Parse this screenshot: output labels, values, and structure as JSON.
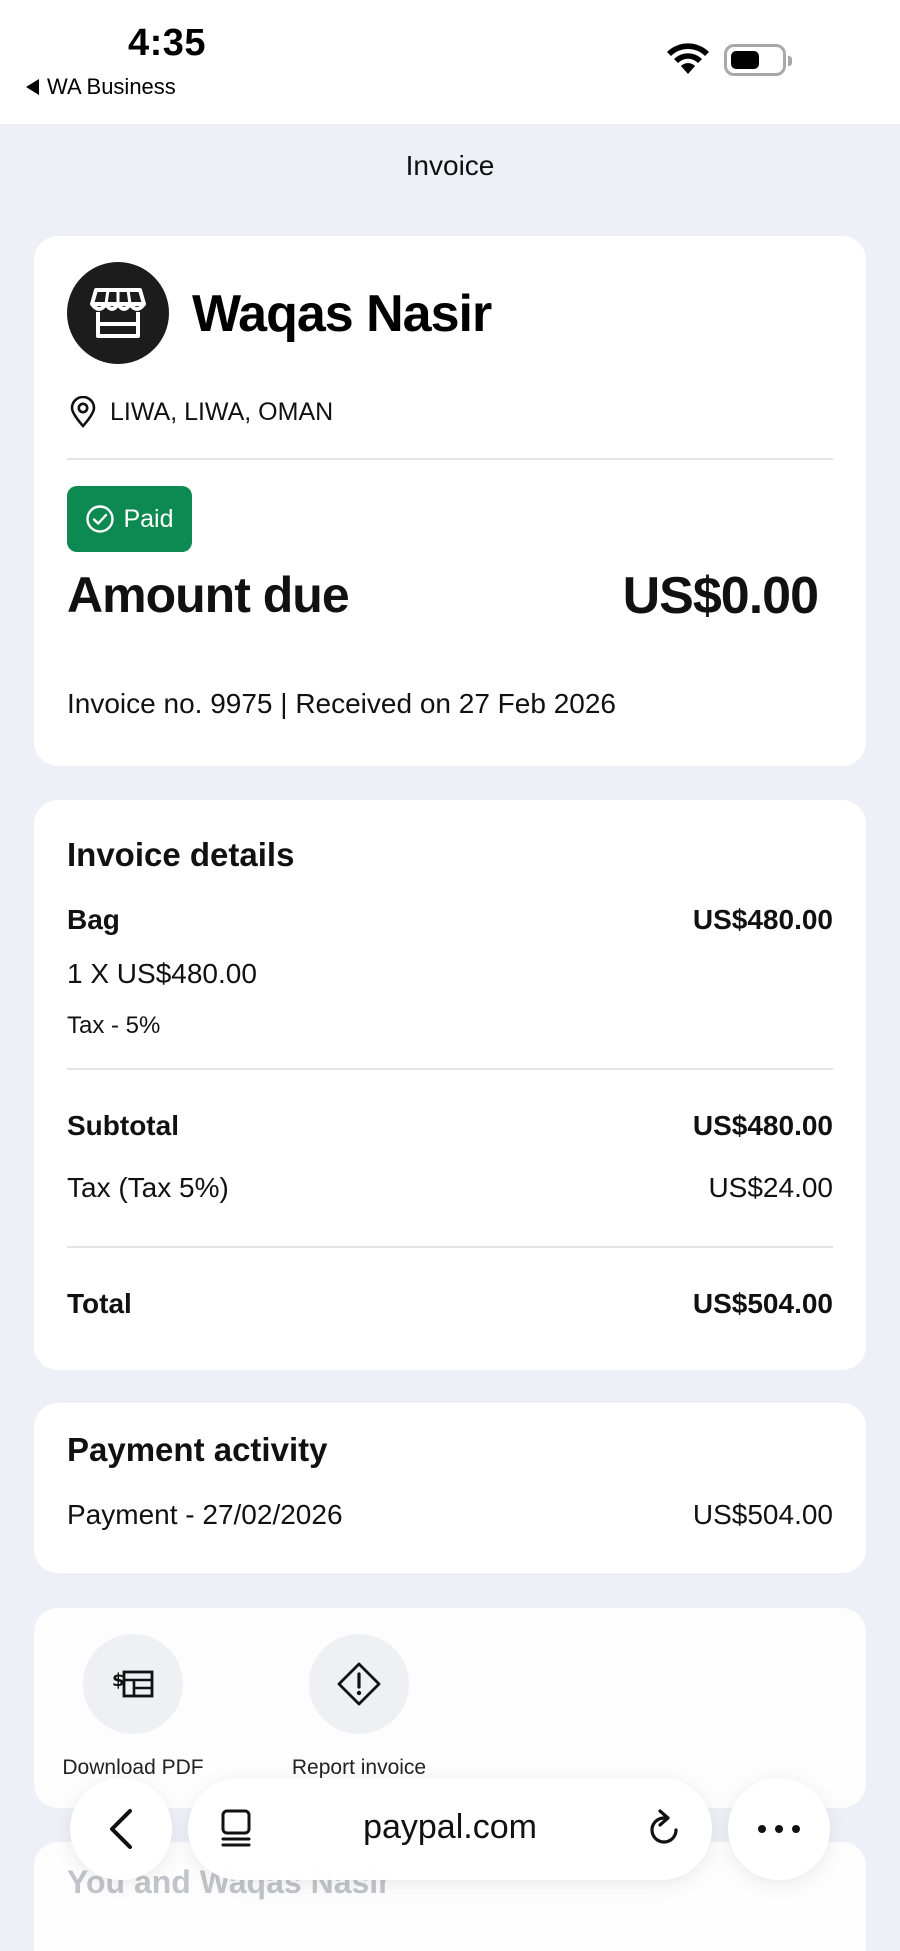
{
  "status_bar": {
    "time": "4:35",
    "back_app": "WA Business"
  },
  "header": {
    "title": "Invoice"
  },
  "merchant": {
    "name": "Waqas Nasir",
    "location": "LIWA, LIWA, OMAN",
    "status_badge": "Paid",
    "amount_label": "Amount due",
    "amount_value": "US$0.00",
    "invoice_meta": "Invoice no. 9975 | Received on 27 Feb 2026"
  },
  "invoice_details": {
    "title": "Invoice details",
    "item": {
      "name": "Bag",
      "amount": "US$480.00",
      "qty_price": "1 X US$480.00",
      "tax": "Tax - 5%"
    },
    "subtotal_label": "Subtotal",
    "subtotal_value": "US$480.00",
    "tax_label": "Tax (Tax 5%)",
    "tax_value": "US$24.00",
    "total_label": "Total",
    "total_value": "US$504.00"
  },
  "payment_activity": {
    "title": "Payment activity",
    "entry_label": "Payment - 27/02/2026",
    "entry_value": "US$504.00"
  },
  "actions": {
    "download_label": "Download PDF",
    "report_label": "Report invoice"
  },
  "faded_section": {
    "title": "You and Waqas Nasir"
  },
  "browser": {
    "url": "paypal.com"
  },
  "colors": {
    "paid_green": "#0d8a52",
    "background": "#edf0f7"
  }
}
